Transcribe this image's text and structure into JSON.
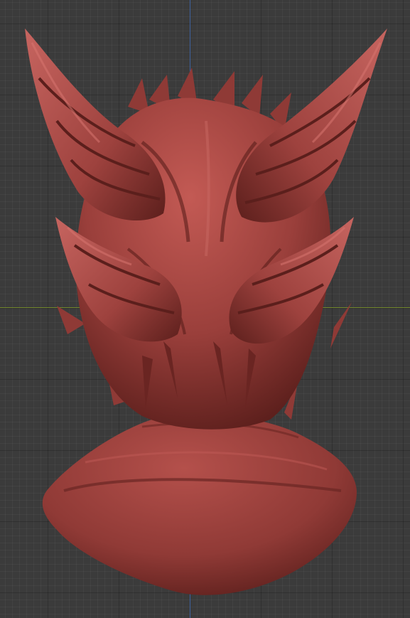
{
  "viewport": {
    "background_color": "#3b3b3b",
    "grid_color": "#2a2a2a",
    "axis_colors": {
      "y_axis": "#3f66a8",
      "x_axis": "#79902c"
    }
  },
  "model": {
    "material_color": "#9a3f3b",
    "highlight_color": "#c8625c",
    "shadow_color": "#4a1715"
  }
}
